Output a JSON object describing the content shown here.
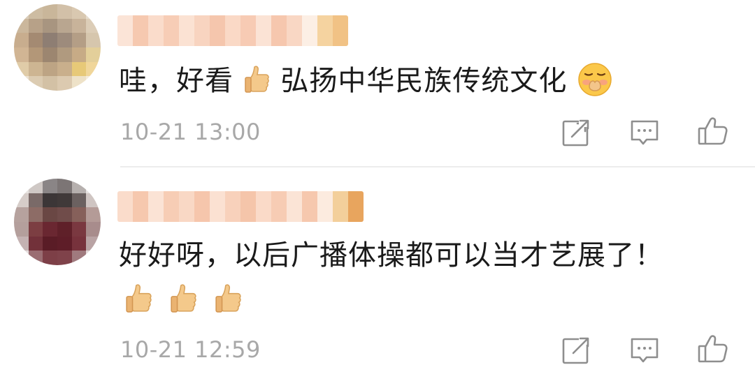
{
  "comments": [
    {
      "text": "哇，好看",
      "text2": "弘扬中华民族传统文化",
      "time": "10-21 13:00"
    },
    {
      "text": "好好呀，以后广播体操都可以当才艺展了！",
      "time": "10-21 12:59"
    }
  ],
  "icons": {
    "share": "share-icon",
    "comment": "comment-icon",
    "like": "thumbs-up-icon"
  }
}
